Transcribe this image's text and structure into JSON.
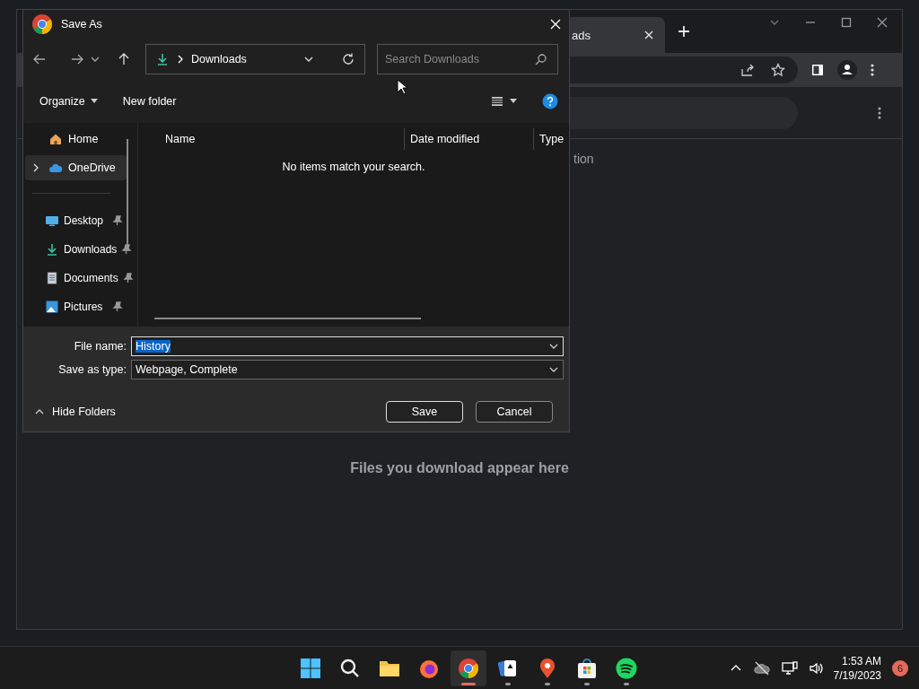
{
  "browser": {
    "tab": {
      "title": "ads"
    },
    "heading_fragment": "tion",
    "empty_message": "Files you download appear here"
  },
  "dialog": {
    "title": "Save As",
    "location": "Downloads",
    "search": {
      "placeholder": "Search Downloads"
    },
    "commands": [
      "Organize",
      "New folder"
    ],
    "nav": [
      {
        "label": "Home",
        "selected": false,
        "expandable": false
      },
      {
        "label": "OneDrive",
        "selected": true,
        "expandable": true
      }
    ],
    "pinned": [
      {
        "label": "Desktop"
      },
      {
        "label": "Downloads"
      },
      {
        "label": "Documents"
      },
      {
        "label": "Pictures"
      }
    ],
    "columns": [
      "Name",
      "Date modified",
      "Type"
    ],
    "empty_message": "No items match your search.",
    "file_name": {
      "label": "File name:",
      "value": "History"
    },
    "save_type": {
      "label": "Save as type:",
      "value": "Webpage, Complete"
    },
    "hide_folders": "Hide Folders",
    "buttons": [
      {
        "label": "Save",
        "kind": "primary"
      },
      {
        "label": "Cancel",
        "kind": "secondary"
      }
    ]
  },
  "taskbar": {
    "apps": [
      {
        "running": false,
        "selected": false
      },
      {
        "running": false,
        "selected": false
      },
      {
        "running": false,
        "selected": false
      },
      {
        "running": false,
        "selected": false
      },
      {
        "running": true,
        "selected": true
      },
      {
        "running": true,
        "selected": false
      },
      {
        "running": true,
        "selected": false
      },
      {
        "running": true,
        "selected": false
      },
      {
        "running": true,
        "selected": false
      }
    ],
    "time": "1:53 AM",
    "date": "7/19/2023",
    "badge": "6"
  }
}
